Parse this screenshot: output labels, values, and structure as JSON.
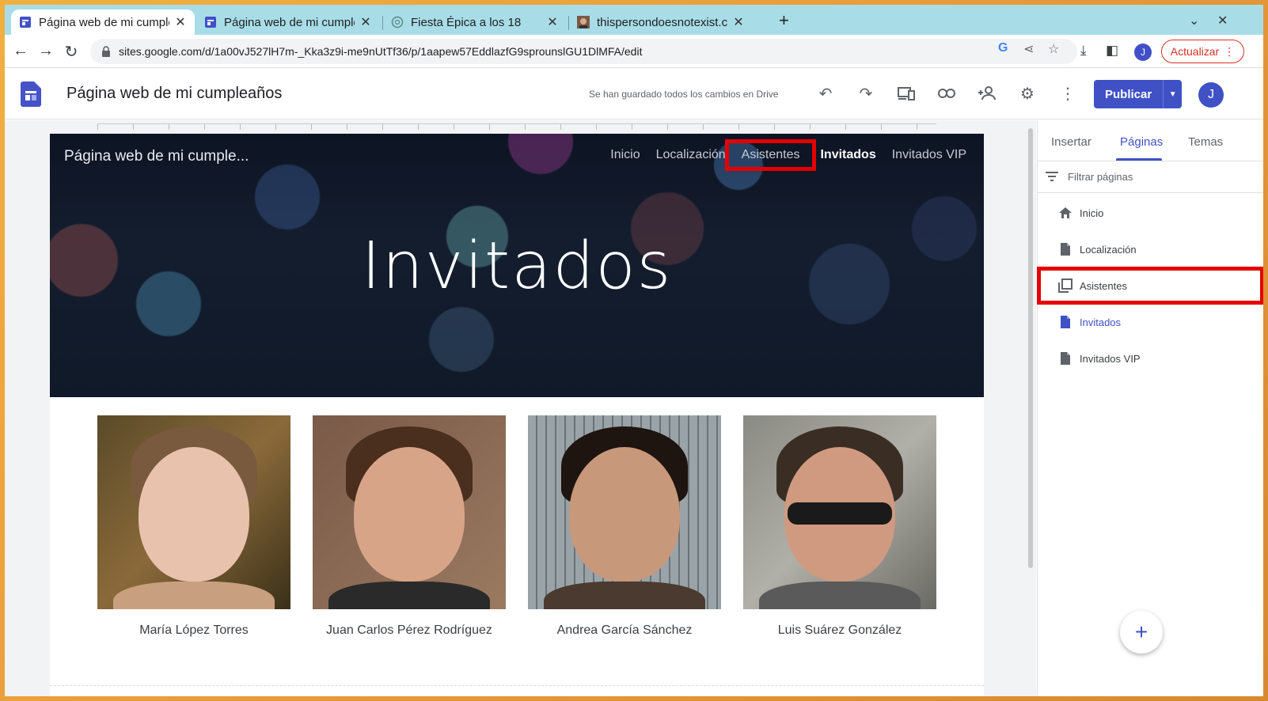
{
  "browser": {
    "tabs": [
      {
        "title": "Página web de mi cumpleaños",
        "active": true
      },
      {
        "title": "Página web de mi cumpleaños",
        "active": false
      },
      {
        "title": "Fiesta Épica a los 18",
        "active": false
      },
      {
        "title": "thispersondoesnotexist.com",
        "active": false
      }
    ],
    "new_tab_label": "+",
    "url": "sites.google.com/d/1a00vJ527lH7m-_Kka3z9i-me9nUtTf36/p/1aapew57EddlazfG9sprounslGU1DlMFA/edit",
    "profile_initial": "J",
    "update_label": "Actualizar"
  },
  "sites": {
    "site_name": "Página web de mi cumpleaños",
    "save_status": "Se han guardado todos los cambios en Drive",
    "publish_label": "Publicar",
    "avatar_initial": "J"
  },
  "hero": {
    "site_title": "Página web de mi cumple...",
    "nav": [
      {
        "label": "Inicio"
      },
      {
        "label": "Localización"
      },
      {
        "label": "Asistentes"
      },
      {
        "label": "Invitados"
      },
      {
        "label": "Invitados VIP"
      }
    ],
    "page_title": "Invitados"
  },
  "people": [
    {
      "name": "María López Torres"
    },
    {
      "name": "Juan Carlos Pérez Rodríguez"
    },
    {
      "name": "Andrea García Sánchez"
    },
    {
      "name": "Luis Suárez González"
    }
  ],
  "panel": {
    "tabs": [
      {
        "label": "Insertar"
      },
      {
        "label": "Páginas"
      },
      {
        "label": "Temas"
      }
    ],
    "filter_placeholder": "Filtrar páginas",
    "pages": [
      {
        "label": "Inicio",
        "icon": "home-icon"
      },
      {
        "label": "Localización",
        "icon": "page-icon"
      },
      {
        "label": "Asistentes",
        "icon": "collection-icon"
      },
      {
        "label": "Invitados",
        "icon": "page-icon"
      },
      {
        "label": "Invitados VIP",
        "icon": "page-icon"
      }
    ],
    "fab_label": "+"
  },
  "colors": {
    "accent": "#3f51c5",
    "highlight": "#e50000",
    "tabstrip": "#a8dde8"
  }
}
